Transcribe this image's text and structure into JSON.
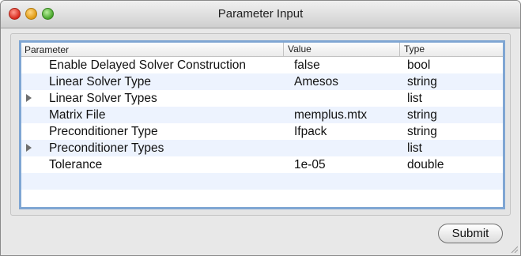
{
  "window": {
    "title": "Parameter Input"
  },
  "table": {
    "columns": [
      "Parameter",
      "Value",
      "Type"
    ],
    "rows": [
      {
        "parameter": "Enable Delayed Solver Construction",
        "value": "false",
        "type": "bool",
        "expandable": false
      },
      {
        "parameter": "Linear Solver Type",
        "value": "Amesos",
        "type": "string",
        "expandable": false
      },
      {
        "parameter": "Linear Solver Types",
        "value": "",
        "type": "list",
        "expandable": true
      },
      {
        "parameter": "Matrix File",
        "value": "memplus.mtx",
        "type": "string",
        "expandable": false
      },
      {
        "parameter": "Preconditioner Type",
        "value": "Ifpack",
        "type": "string",
        "expandable": false
      },
      {
        "parameter": "Preconditioner Types",
        "value": "",
        "type": "list",
        "expandable": true
      },
      {
        "parameter": "Tolerance",
        "value": "1e-05",
        "type": "double",
        "expandable": false
      }
    ]
  },
  "footer": {
    "submit_label": "Submit"
  },
  "icons": {
    "disclosure": "disclosure-triangle-icon",
    "resize": "resize-grip-icon"
  },
  "colors": {
    "selection_border": "#7fa6d3",
    "alt_row": "#edf3fe"
  }
}
